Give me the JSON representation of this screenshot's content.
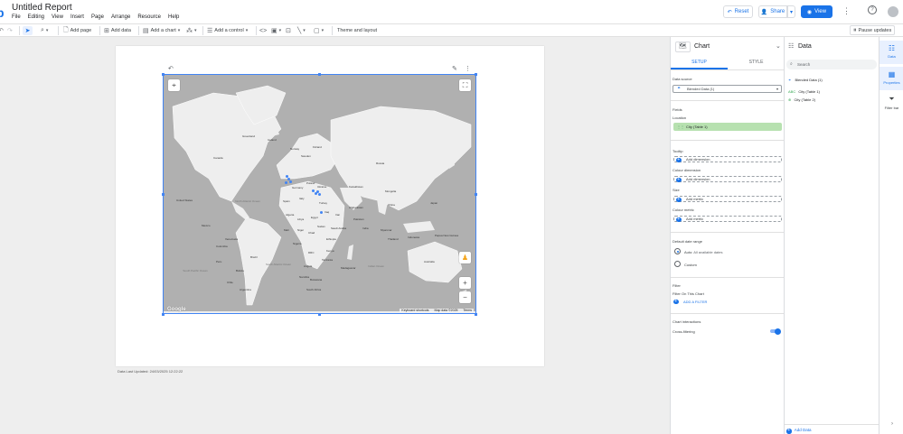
{
  "header": {
    "logo_glyph": "b",
    "title": "Untitled Report",
    "menu": [
      "File",
      "Editing",
      "View",
      "Insert",
      "Page",
      "Arrange",
      "Resource",
      "Help"
    ],
    "reset_label": "Reset",
    "share_label": "Share",
    "view_label": "View"
  },
  "toolbar": {
    "add_page": "Add page",
    "add_data": "Add data",
    "add_chart": "Add a chart",
    "add_control": "Add a control",
    "theme_layout": "Theme and layout",
    "pause_updates": "Pause updates"
  },
  "canvas": {
    "last_updated": "Data Last Updated: 24/03/2025 12:22:22"
  },
  "map": {
    "labels": [
      {
        "t": "Greenland"
      },
      {
        "t": "Iceland"
      },
      {
        "t": "Canada"
      },
      {
        "t": "United States"
      },
      {
        "t": "Mexico"
      },
      {
        "t": "Venezuela"
      },
      {
        "t": "Colombia"
      },
      {
        "t": "Peru"
      },
      {
        "t": "Brazil"
      },
      {
        "t": "Bolivia"
      },
      {
        "t": "Chile"
      },
      {
        "t": "Argentina"
      },
      {
        "t": "Norway"
      },
      {
        "t": "Sweden"
      },
      {
        "t": "Finland"
      },
      {
        "t": "Germany"
      },
      {
        "t": "Poland"
      },
      {
        "t": "Ukraine"
      },
      {
        "t": "Spain"
      },
      {
        "t": "Italy"
      },
      {
        "t": "Turkey"
      },
      {
        "t": "Russia"
      },
      {
        "t": "Kazakhstan"
      },
      {
        "t": "Mongolia"
      },
      {
        "t": "China"
      },
      {
        "t": "Japan"
      },
      {
        "t": "Iran"
      },
      {
        "t": "Iraq"
      },
      {
        "t": "Afghanistan"
      },
      {
        "t": "Pakistan"
      },
      {
        "t": "India"
      },
      {
        "t": "Myanmar"
      },
      {
        "t": "Thailand"
      },
      {
        "t": "Saudi Arabia"
      },
      {
        "t": "Egypt"
      },
      {
        "t": "Libya"
      },
      {
        "t": "Algeria"
      },
      {
        "t": "Mali"
      },
      {
        "t": "Niger"
      },
      {
        "t": "Chad"
      },
      {
        "t": "Sudan"
      },
      {
        "t": "Ethiopia"
      },
      {
        "t": "Nigeria"
      },
      {
        "t": "Kenya"
      },
      {
        "t": "DRC"
      },
      {
        "t": "Tanzania"
      },
      {
        "t": "Angola"
      },
      {
        "t": "Namibia"
      },
      {
        "t": "Botswana"
      },
      {
        "t": "South Africa"
      },
      {
        "t": "Madagascar"
      },
      {
        "t": "Indonesia"
      },
      {
        "t": "Papua New Guinea"
      },
      {
        "t": "Australia"
      }
    ],
    "oceans": [
      {
        "t": "North Atlantic Ocean"
      },
      {
        "t": "South Atlantic Ocean"
      },
      {
        "t": "Indian Ocean"
      },
      {
        "t": "South Pacific Ocean"
      }
    ],
    "footer": [
      "Keyboard shortcuts",
      "Map data ©2025",
      "Terms"
    ],
    "google": "Google"
  },
  "chart_panel": {
    "title": "Chart",
    "tab_setup": "SETUP",
    "tab_style": "STYLE",
    "data_source_label": "Data source",
    "data_source_value": "Blended Data (1)",
    "fields_label": "Fields",
    "location_label": "Location",
    "location_value": "City (Table 1)",
    "tooltip_label": "Tooltip",
    "add_dimension": "Add dimension",
    "colour_dimension_label": "Colour dimension",
    "size_label": "Size",
    "add_metric": "Add metric",
    "colour_metric_label": "Colour metric",
    "date_range_label": "Default date range",
    "auto_label": "Auto",
    "auto_value": "All available dates",
    "custom_label": "Custom",
    "filter_label": "Filter",
    "filter_on_chart": "Filter On This Chart",
    "add_filter": "ADD A FILTER",
    "interactions_label": "Chart interactions",
    "cross_filtering": "Cross-filtering"
  },
  "data_panel": {
    "title": "Data",
    "search_placeholder": "Search",
    "blended": "Blended Data (1)",
    "fields": [
      "City (Table 1)",
      "City (Table 2)"
    ],
    "add_data": "Add Data"
  },
  "rail": {
    "data": "Data",
    "properties": "Properties",
    "filter_bar": "Filter bar"
  },
  "colors": {
    "accent": "#1a73e8",
    "selected_field": "#b7e1b0"
  }
}
